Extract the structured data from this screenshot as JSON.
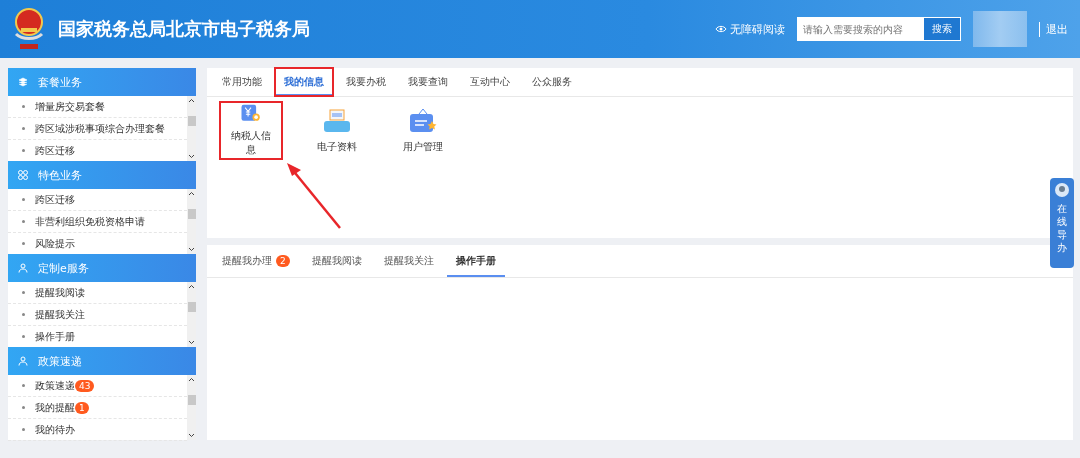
{
  "header": {
    "title": "国家税务总局北京市电子税务局",
    "accessibility": "无障碍阅读",
    "search": {
      "placeholder": "请输入需要搜索的内容",
      "button": "搜索"
    },
    "logout": "退出"
  },
  "sidebar": [
    {
      "title": "套餐业务",
      "kind": "layers",
      "items": [
        {
          "label": "增量房交易套餐"
        },
        {
          "label": "跨区域涉税事项综合办理套餐"
        },
        {
          "label": "跨区迁移"
        }
      ]
    },
    {
      "title": "特色业务",
      "kind": "grid",
      "items": [
        {
          "label": "跨区迁移"
        },
        {
          "label": "非营利组织免税资格申请"
        },
        {
          "label": "风险提示"
        }
      ]
    },
    {
      "title": "定制e服务",
      "kind": "user",
      "items": [
        {
          "label": "提醒我阅读"
        },
        {
          "label": "提醒我关注"
        },
        {
          "label": "操作手册"
        }
      ]
    },
    {
      "title": "政策速递",
      "kind": "user",
      "items": [
        {
          "label": "政策速递",
          "badge": "43"
        },
        {
          "label": "我的提醒",
          "badge": "1"
        },
        {
          "label": "我的待办"
        }
      ]
    }
  ],
  "main_tabs": [
    {
      "label": "常用功能",
      "selected": false,
      "highlighted": false
    },
    {
      "label": "我的信息",
      "selected": true,
      "highlighted": true
    },
    {
      "label": "我要办税",
      "selected": false,
      "highlighted": false
    },
    {
      "label": "我要查询",
      "selected": false,
      "highlighted": false
    },
    {
      "label": "互动中心",
      "selected": false,
      "highlighted": false
    },
    {
      "label": "公众服务",
      "selected": false,
      "highlighted": false
    }
  ],
  "functions": [
    {
      "label": "纳税人信息",
      "kind": "taxpayer",
      "highlighted": true
    },
    {
      "label": "电子资料",
      "kind": "scanner",
      "highlighted": false
    },
    {
      "label": "用户管理",
      "kind": "badge",
      "highlighted": false
    }
  ],
  "reminder_tabs": [
    {
      "label": "提醒我办理",
      "badge": "2",
      "selected": false
    },
    {
      "label": "提醒我阅读",
      "selected": false
    },
    {
      "label": "提醒我关注",
      "selected": false
    },
    {
      "label": "操作手册",
      "selected": true
    }
  ],
  "float_button": "在线导办"
}
